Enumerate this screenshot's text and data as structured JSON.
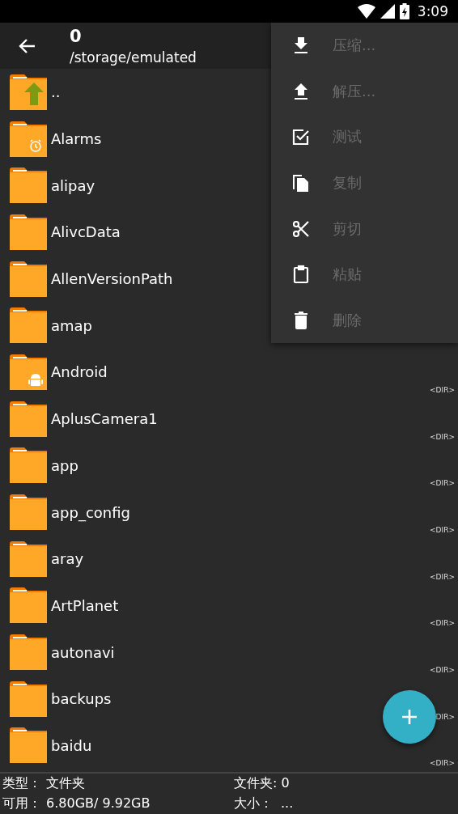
{
  "status_bar": {
    "time": "3:09"
  },
  "header": {
    "title": "0",
    "path": "/storage/emulated"
  },
  "rows": [
    {
      "name": "..",
      "kind": "up"
    },
    {
      "name": "Alarms",
      "kind": "alarm"
    },
    {
      "name": "alipay",
      "kind": "folder"
    },
    {
      "name": "AlivcData",
      "kind": "folder"
    },
    {
      "name": "AllenVersionPath",
      "kind": "folder"
    },
    {
      "name": "amap",
      "kind": "folder"
    },
    {
      "name": "Android",
      "kind": "android",
      "tag": "<DIR>"
    },
    {
      "name": "AplusCamera1",
      "kind": "folder",
      "tag": "<DIR>"
    },
    {
      "name": "app",
      "kind": "folder",
      "tag": "<DIR>"
    },
    {
      "name": "app_config",
      "kind": "folder",
      "tag": "<DIR>"
    },
    {
      "name": "aray",
      "kind": "folder",
      "tag": "<DIR>"
    },
    {
      "name": "ArtPlanet",
      "kind": "folder",
      "tag": "<DIR>"
    },
    {
      "name": "autonavi",
      "kind": "folder",
      "tag": "<DIR>"
    },
    {
      "name": "backups",
      "kind": "folder",
      "tag": "DIR>"
    },
    {
      "name": "baidu",
      "kind": "folder",
      "tag": "<DIR>"
    }
  ],
  "menu": [
    {
      "label": "压缩...",
      "kind": "compress",
      "disabled": true
    },
    {
      "label": "解压...",
      "kind": "extract",
      "disabled": true
    },
    {
      "label": "测试",
      "kind": "test",
      "disabled": true
    },
    {
      "label": "复制",
      "kind": "copy",
      "disabled": true
    },
    {
      "label": "剪切",
      "kind": "cut",
      "disabled": true
    },
    {
      "label": "粘贴",
      "kind": "paste",
      "disabled": true
    },
    {
      "label": "删除",
      "kind": "delete",
      "disabled": true
    }
  ],
  "info": {
    "type_label": "类型：",
    "type_value": "文件夹",
    "folders": "文件夹: 0",
    "free_label": "可用：",
    "free_value": "6.80GB/ 9.92GB",
    "size_label": "大小：",
    "size_value": "..."
  }
}
